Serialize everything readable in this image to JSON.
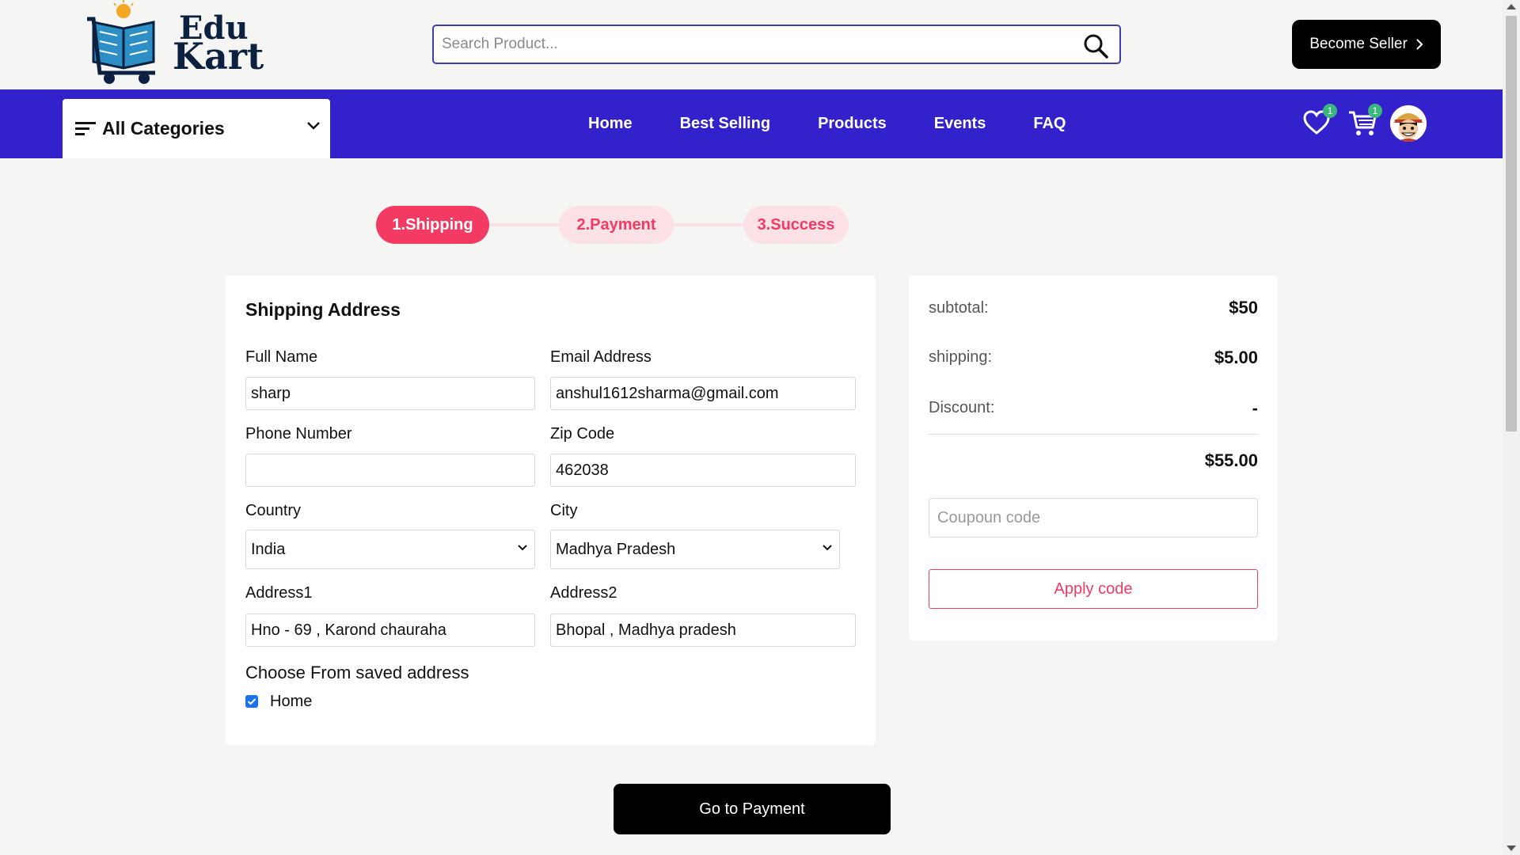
{
  "header": {
    "logo_line1": "Edu",
    "logo_line2": "Kart",
    "search_placeholder": "Search Product...",
    "become_seller_label": "Become Seller",
    "icons": [
      "search-icon",
      "chevron-right-icon"
    ]
  },
  "nav": {
    "categories_label": "All Categories",
    "links": [
      "Home",
      "Best Selling",
      "Products",
      "Events",
      "FAQ"
    ],
    "wishlist_count": "1",
    "cart_count": "1",
    "icons": [
      "menu-icon",
      "chevron-down-icon",
      "heart-icon",
      "cart-icon",
      "avatar"
    ]
  },
  "steps": [
    "1.Shipping",
    "2.Payment",
    "3.Success"
  ],
  "shipping": {
    "title": "Shipping Address",
    "full_name_label": "Full Name",
    "full_name": "sharp",
    "email_label": "Email Address",
    "email": "anshul1612sharma@gmail.com",
    "phone_label": "Phone Number",
    "phone": "",
    "zip_label": "Zip Code",
    "zip": "462038",
    "country_label": "Country",
    "country": "India",
    "city_label": "City",
    "city": "Madhya Pradesh",
    "address1_label": "Address1",
    "address1": "Hno - 69 , Karond chauraha",
    "address2_label": "Address2",
    "address2": "Bhopal , Madhya pradesh",
    "saved_title": "Choose From saved address",
    "saved_option": "Home",
    "saved_checked": true
  },
  "summary": {
    "subtotal_label": "subtotal:",
    "subtotal": "$50",
    "shipping_label": "shipping:",
    "shipping": "$5.00",
    "discount_label": "Discount:",
    "discount": "-",
    "total": "$55.00",
    "coupon_placeholder": "Coupoun code",
    "apply_label": "Apply code"
  },
  "go_to_payment_label": "Go to Payment",
  "colors": {
    "nav_bg": "#3321cc",
    "accent": "#f23a62",
    "accent_light": "#fce1e7",
    "badge": "#3bb77e"
  }
}
